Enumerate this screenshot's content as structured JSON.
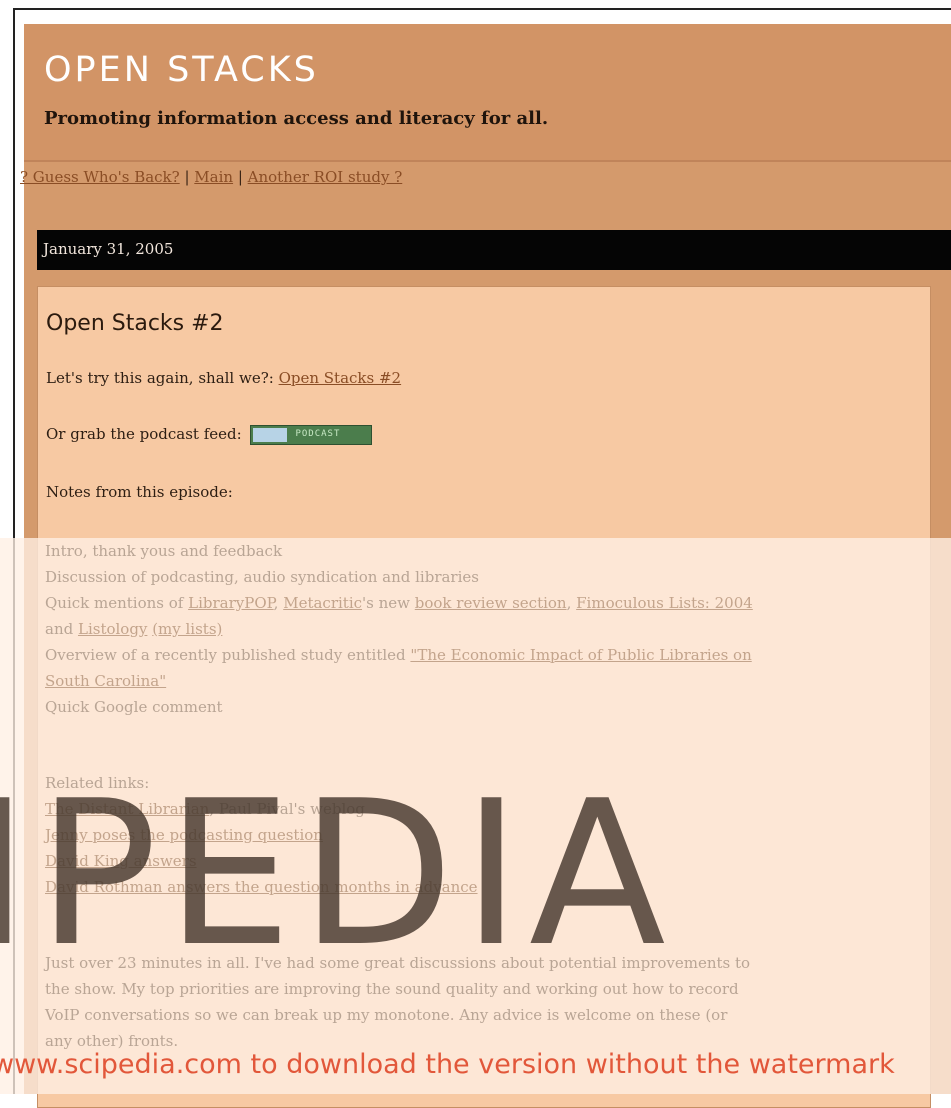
{
  "header": {
    "title": "OPEN STACKS",
    "tagline": "Promoting information access and literacy for all."
  },
  "nav": {
    "prev": "? Guess Who's Back?",
    "sep1": " | ",
    "main": "Main",
    "sep2": " | ",
    "next": "Another ROI study ?"
  },
  "date": "January 31, 2005",
  "entry": {
    "title": "Open Stacks #2",
    "line1_text": "Let's try this again, shall we?: ",
    "line1_link": "Open Stacks #2",
    "line2_text": "Or grab the podcast feed: ",
    "podcast_badge": "PODCAST",
    "line3": "Notes from this episode:",
    "notes": {
      "n1": "Intro, thank yous and feedback",
      "n2": "Discussion of podcasting, audio syndication and libraries",
      "n3_text": "Quick mentions of ",
      "n3_link1": "LibraryPOP",
      "n3_sep1": ", ",
      "n3_link2": "Metacritic",
      "n3_mid": "'s new ",
      "n3_link3": "book review section",
      "n3_sep2": ", ",
      "n3_link4": "Fimoculous Lists: 2004",
      "n4_text": "and ",
      "n4_link1": "Listology",
      "n4_sp": " ",
      "n4_link2": "(my lists)",
      "n5_text": "Overview of a recently published study entitled ",
      "n5_link": "\"The Economic Impact of Public Libraries on",
      "n6_link": "South Carolina\"",
      "n7": "Quick Google comment"
    },
    "related": {
      "heading": "Related links:",
      "r1_link": "The Distant Librarian",
      "r1_sep": ", ",
      "r1_text": "Paul Pival's weblog",
      "r2_link": "Jenny poses the podcasting question",
      "r3_link": "David King answers",
      "r4_link": "David Rothman answers the question months in advance"
    },
    "closing": {
      "c1": "Just over 23 minutes in all. I've had some great discussions about potential improvements to",
      "c2": "the show. My top priorities are improving the sound quality and working out how to record",
      "c3": "VoIP conversations so we can break up my monotone. Any advice is welcome on these (or",
      "c4": "any other) fronts."
    }
  },
  "watermark": {
    "letters": "IPEDIA",
    "caption": "www.scipedia.com to download the version without the watermark"
  },
  "colors": {
    "header_bg": "#d29466",
    "entry_bg": "#f7c9a3",
    "date_bar_bg": "#050505",
    "link": "#8a4d25",
    "watermark_caption": "#e2573a"
  }
}
